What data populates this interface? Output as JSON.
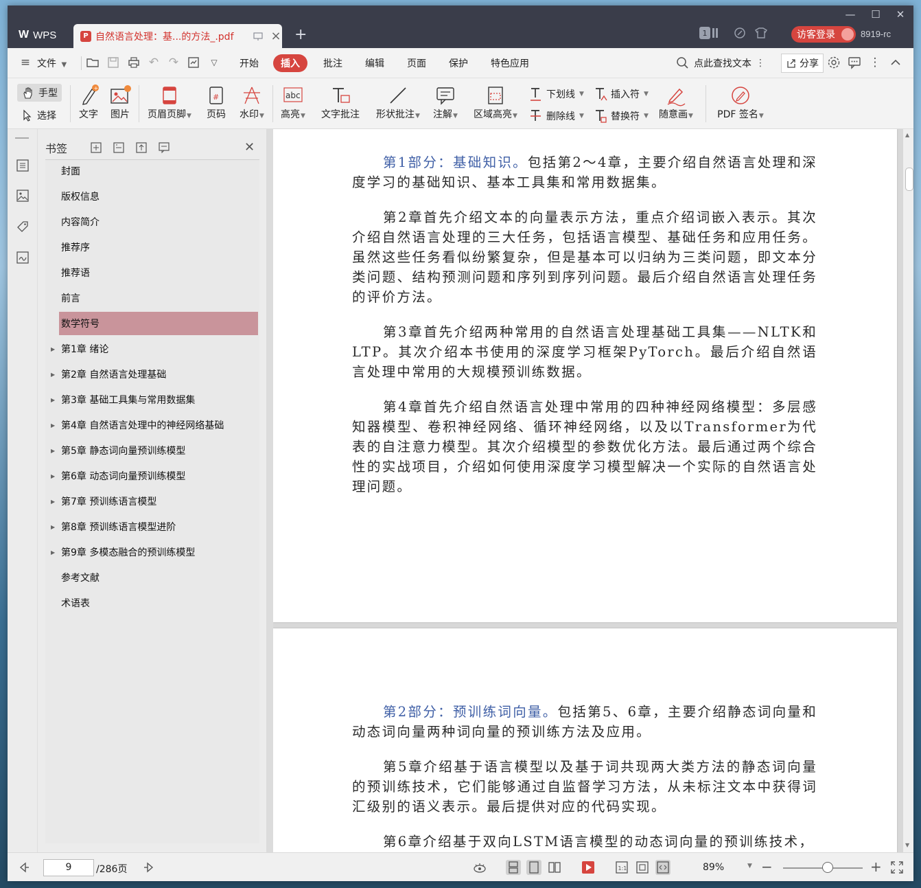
{
  "titlebar": {
    "app_name": "WPS",
    "doc_tab_title": "自然语言处理：基...的方法_.pdf",
    "new_tab": "+",
    "badge_count": "1",
    "login_label": "访客登录",
    "user_name": "8919-rc",
    "minimize": "—",
    "maximize": "☐",
    "close": "✕"
  },
  "menubar": {
    "file_label": "文件",
    "tabs": [
      "开始",
      "插入",
      "批注",
      "编辑",
      "页面",
      "保护",
      "特色应用"
    ],
    "active_tab": "插入",
    "search_label": "点此查找文本",
    "share_label": "分享"
  },
  "ribbon": {
    "hand_label": "手型",
    "select_label": "选择",
    "text_label": "文字",
    "image_label": "图片",
    "header_footer_label": "页眉页脚",
    "page_number_label": "页码",
    "watermark_label": "水印",
    "highlight_label": "高亮",
    "text_annot_label": "文字批注",
    "shape_annot_label": "形状批注",
    "note_label": "注解",
    "area_highlight_label": "区域高亮",
    "underline_label": "下划线",
    "strikethrough_label": "删除线",
    "insert_mark_label": "插入符",
    "replace_mark_label": "替换符",
    "freehand_label": "随意画",
    "pdf_sign_label": "PDF 签名"
  },
  "bookmark_panel": {
    "title": "书签",
    "items": [
      {
        "label": "封面",
        "expandable": false
      },
      {
        "label": "版权信息",
        "expandable": false
      },
      {
        "label": "内容简介",
        "expandable": false
      },
      {
        "label": "推荐序",
        "expandable": false
      },
      {
        "label": "推荐语",
        "expandable": false
      },
      {
        "label": "前言",
        "expandable": false
      },
      {
        "label": "数学符号",
        "expandable": false,
        "active": true
      },
      {
        "label": "第1章 绪论",
        "expandable": true
      },
      {
        "label": "第2章 自然语言处理基础",
        "expandable": true
      },
      {
        "label": "第3章 基础工具集与常用数据集",
        "expandable": true
      },
      {
        "label": "第4章 自然语言处理中的神经网络基础",
        "expandable": true
      },
      {
        "label": "第5章 静态词向量预训练模型",
        "expandable": true
      },
      {
        "label": "第6章 动态词向量预训练模型",
        "expandable": true
      },
      {
        "label": "第7章 预训练语言模型",
        "expandable": true
      },
      {
        "label": "第8章 预训练语言模型进阶",
        "expandable": true
      },
      {
        "label": "第9章 多模态融合的预训练模型",
        "expandable": true
      },
      {
        "label": "参考文献",
        "expandable": false
      },
      {
        "label": "术语表",
        "expandable": false
      }
    ]
  },
  "document": {
    "page1": {
      "p1_highlight": "第1部分：基础知识。",
      "p1_rest": "包括第2～4章，主要介绍自然语言处理和深度学习的基础知识、基本工具集和常用数据集。",
      "p2": "第2章首先介绍文本的向量表示方法，重点介绍词嵌入表示。其次介绍自然语言处理的三大任务，包括语言模型、基础任务和应用任务。虽然这些任务看似纷繁复杂，但是基本可以归纳为三类问题，即文本分类问题、结构预测问题和序列到序列问题。最后介绍自然语言处理任务的评价方法。",
      "p3": "第3章首先介绍两种常用的自然语言处理基础工具集——NLTK和LTP。其次介绍本书使用的深度学习框架PyTorch。最后介绍自然语言处理中常用的大规模预训练数据。",
      "p4": "第4章首先介绍自然语言处理中常用的四种神经网络模型：多层感知器模型、卷积神经网络、循环神经网络，以及以Transformer为代表的自注意力模型。其次介绍模型的参数优化方法。最后通过两个综合性的实战项目，介绍如何使用深度学习模型解决一个实际的自然语言处理问题。"
    },
    "page2": {
      "p1_highlight": "第2部分：预训练词向量。",
      "p1_rest": "包括第5、6章，主要介绍静态词向量和动态词向量两种词向量的预训练方法及应用。",
      "p2": "第5章介绍基于语言模型以及基于词共现两大类方法的静态词向量的预训练技术，它们能够通过自监督学习方法，从未标注文本中获得词汇级别的语义表示。最后提供对应的代码实现。",
      "p3": "第6章介绍基于双向LSTM语言模型的动态词向量的预训练技术，"
    }
  },
  "statusbar": {
    "current_page": "9",
    "total_pages": "/286页",
    "zoom": "89%",
    "zoom_level_percent": 89
  }
}
